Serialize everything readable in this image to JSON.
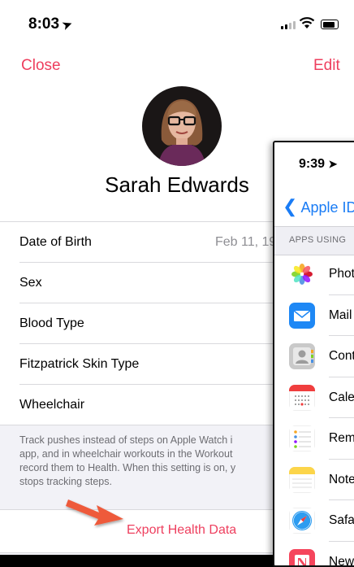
{
  "left_screen": {
    "status_time": "8:03",
    "nav": {
      "close_label": "Close",
      "edit_label": "Edit"
    },
    "profile_name": "Sarah Edwards",
    "rows": [
      {
        "label": "Date of Birth",
        "value": "Feb 11, 19"
      },
      {
        "label": "Sex",
        "value": ""
      },
      {
        "label": "Blood Type",
        "value": ""
      },
      {
        "label": "Fitzpatrick Skin Type",
        "value": ""
      },
      {
        "label": "Wheelchair",
        "value": ""
      }
    ],
    "footnote": {
      "line1": "Track pushes instead of steps on Apple Watch i",
      "line2": "app, and in wheelchair workouts in the Workout",
      "line3": "record them to Health. When this setting is on, y",
      "line4": "stops tracking steps."
    },
    "export_label": "Export Health Data"
  },
  "right_screen": {
    "status_time": "9:39",
    "back_label": "Apple ID",
    "section_header": "APPS USING",
    "apps": [
      {
        "label": "Phot",
        "icon": "photos-icon"
      },
      {
        "label": "Mail",
        "icon": "mail-icon"
      },
      {
        "label": "Cont",
        "icon": "contacts-icon"
      },
      {
        "label": "Cale",
        "icon": "calendar-icon"
      },
      {
        "label": "Rem",
        "icon": "reminders-icon"
      },
      {
        "label": "Note",
        "icon": "notes-icon"
      },
      {
        "label": "Safa",
        "icon": "safari-icon"
      },
      {
        "label": "New",
        "icon": "news-icon"
      }
    ]
  },
  "colors": {
    "accent_pink": "#ee3f5e",
    "ios_blue": "#1a7cf5",
    "arrow_red": "#ee5a3a"
  }
}
